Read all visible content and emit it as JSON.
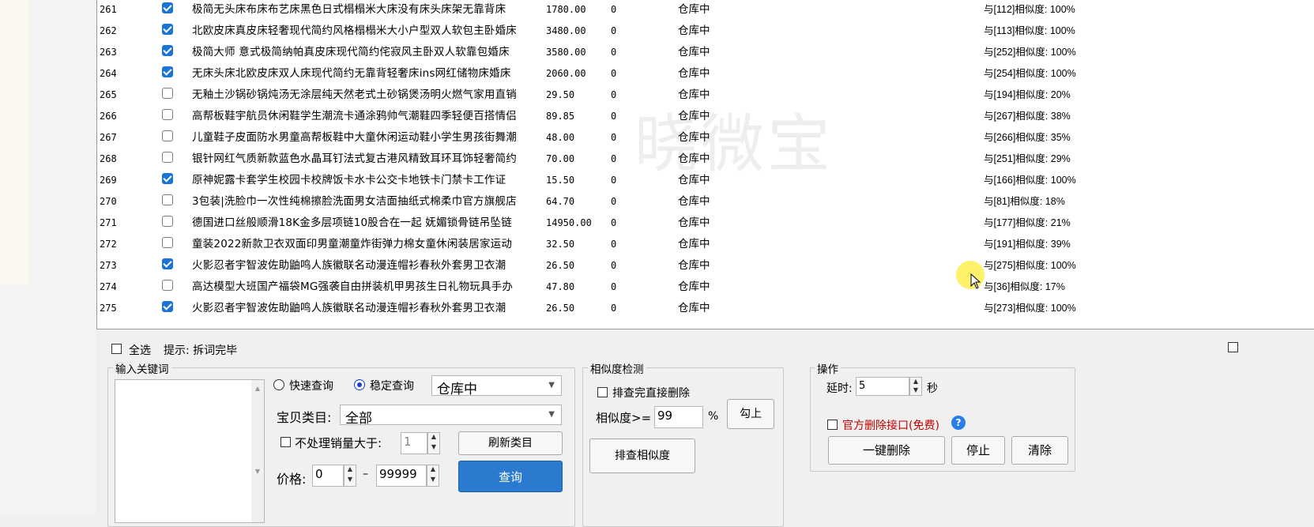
{
  "rows": [
    {
      "id": "261",
      "checked": true,
      "title": "极简无头床布床布艺床黑色日式榻榻米大床没有床头床架无靠背床",
      "price": "1780.00",
      "sales": "0",
      "status": "仓库中",
      "sim": "与[112]相似度: 100%"
    },
    {
      "id": "262",
      "checked": true,
      "title": "北欧皮床真皮床轻奢现代简约风格榻榻米大小户型双人软包主卧婚床",
      "price": "3480.00",
      "sales": "0",
      "status": "仓库中",
      "sim": "与[113]相似度: 100%"
    },
    {
      "id": "263",
      "checked": true,
      "title": "极简大师 意式极简纳帕真皮床现代简约侘寂风主卧双人软靠包婚床",
      "price": "3580.00",
      "sales": "0",
      "status": "仓库中",
      "sim": "与[252]相似度: 100%"
    },
    {
      "id": "264",
      "checked": true,
      "title": "无床头床北欧皮床双人床现代简约无靠背轻奢床ins网红储物床婚床",
      "price": "2060.00",
      "sales": "0",
      "status": "仓库中",
      "sim": "与[254]相似度: 100%"
    },
    {
      "id": "265",
      "checked": false,
      "title": "无釉土沙锅砂锅炖汤无涂层纯天然老式土砂锅煲汤明火燃气家用直销",
      "price": "29.50",
      "sales": "0",
      "status": "仓库中",
      "sim": "与[194]相似度: 20%"
    },
    {
      "id": "266",
      "checked": false,
      "title": "高帮板鞋宇航员休闲鞋学生潮流卡通涂鸦帅气潮鞋四季轻便百搭情侣",
      "price": "89.85",
      "sales": "0",
      "status": "仓库中",
      "sim": "与[267]相似度: 38%"
    },
    {
      "id": "267",
      "checked": false,
      "title": "儿童鞋子皮面防水男童高帮板鞋中大童休闲运动鞋小学生男孩街舞潮",
      "price": "48.00",
      "sales": "0",
      "status": "仓库中",
      "sim": "与[266]相似度: 35%"
    },
    {
      "id": "268",
      "checked": false,
      "title": "银针网红气质新款蓝色水晶耳钉法式复古港风精致耳环耳饰轻奢简约",
      "price": "70.00",
      "sales": "0",
      "status": "仓库中",
      "sim": "与[251]相似度: 29%"
    },
    {
      "id": "269",
      "checked": true,
      "title": "原神妮露卡套学生校园卡校牌饭卡水卡公交卡地铁卡门禁卡工作证",
      "price": "15.50",
      "sales": "0",
      "status": "仓库中",
      "sim": "与[166]相似度: 100%"
    },
    {
      "id": "270",
      "checked": false,
      "title": "3包装|洗脸巾一次性纯棉擦脸洗面男女洁面抽纸式棉柔巾官方旗舰店",
      "price": "64.70",
      "sales": "0",
      "status": "仓库中",
      "sim": "与[81]相似度: 18%"
    },
    {
      "id": "271",
      "checked": false,
      "title": "德国进口丝般顺滑18K金多层项链10股合在一起 妩媚锁骨链吊坠链",
      "price": "14950.00",
      "sales": "0",
      "status": "仓库中",
      "sim": "与[177]相似度: 21%"
    },
    {
      "id": "272",
      "checked": false,
      "title": "童装2022新款卫衣双面印男童潮童炸街弹力棉女童休闲装居家运动",
      "price": "32.50",
      "sales": "0",
      "status": "仓库中",
      "sim": "与[191]相似度: 39%"
    },
    {
      "id": "273",
      "checked": true,
      "title": "火影忍者宇智波佐助鼬鸣人族徽联名动漫连帽衫春秋外套男卫衣潮",
      "price": "26.50",
      "sales": "0",
      "status": "仓库中",
      "sim": "与[275]相似度: 100%"
    },
    {
      "id": "274",
      "checked": false,
      "title": "高达模型大班国产福袋MG强袭自由拼装机甲男孩生日礼物玩具手办",
      "price": "47.80",
      "sales": "0",
      "status": "仓库中",
      "sim": "与[36]相似度: 17%"
    },
    {
      "id": "275",
      "checked": true,
      "title": "火影忍者宇智波佐助鼬鸣人族徽联名动漫连帽衫春秋外套男卫衣潮",
      "price": "26.50",
      "sales": "0",
      "status": "仓库中",
      "sim": "与[273]相似度: 100%"
    }
  ],
  "watermark": "晓微宝",
  "footer": {
    "select_all": "全选",
    "hint": "提示: 拆词完毕"
  },
  "keywords": {
    "title": "输入关键词"
  },
  "query": {
    "fast_label": "快速查询",
    "stable_label": "稳定查询",
    "mode": "stable",
    "status_value": "仓库中",
    "category_label": "宝贝类目:",
    "category_value": "全部",
    "sales_filter_label": "不处理销量大于:",
    "sales_filter_value": "1",
    "refresh_label": "刷新类目",
    "price_label": "价格:",
    "price_min": "0",
    "price_dash": "–",
    "price_max": "99999",
    "query_label": "查询"
  },
  "similarity": {
    "title": "相似度检测",
    "delete_direct_label": "排查完直接删除",
    "threshold_label": "相似度>=",
    "threshold_value": "99",
    "percent": "%",
    "check_label": "勾上",
    "scan_label": "排查相似度"
  },
  "ops": {
    "title": "操作",
    "delay_label": "延时:",
    "delay_value": "5",
    "delay_unit": "秒",
    "official_api_label": "官方删除接口(免费)",
    "help": "?",
    "delete_all_label": "一键删除",
    "stop_label": "停止",
    "clear_label": "清除"
  },
  "colors": {
    "checkbox_checked": "#1a73d9",
    "official_api_text": "#c00000"
  }
}
